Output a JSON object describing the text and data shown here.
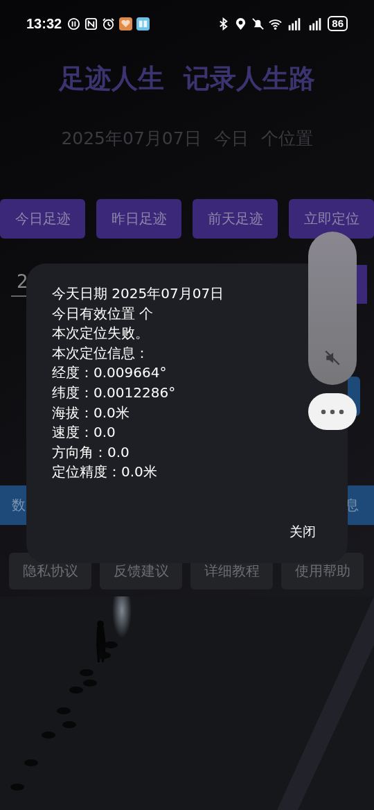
{
  "status_bar": {
    "time": "13:32",
    "battery": "86"
  },
  "title": [
    "足迹人生",
    "记录人生路"
  ],
  "summary": [
    "2025年07月07日",
    "今日",
    "个位置"
  ],
  "day_buttons": [
    "今日足迹",
    "昨日足迹",
    "前天足迹",
    "立即定位"
  ],
  "field": {
    "value": "2"
  },
  "action_row": [
    "数",
    "息"
  ],
  "footer_buttons": [
    "隐私协议",
    "反馈建议",
    "详细教程",
    "使用帮助"
  ],
  "dialog": {
    "lines": [
      "今天日期 2025年07月07日",
      "今日有效位置  个",
      "本次定位失败。",
      "本次定位信息：",
      "经度：0.009664°",
      "纬度：0.0012286°",
      "海拔：0.0米",
      "速度：0.0",
      "方向角：0.0",
      "定位精度：0.0米"
    ],
    "close": "关闭"
  },
  "volume": {
    "muted": true
  }
}
